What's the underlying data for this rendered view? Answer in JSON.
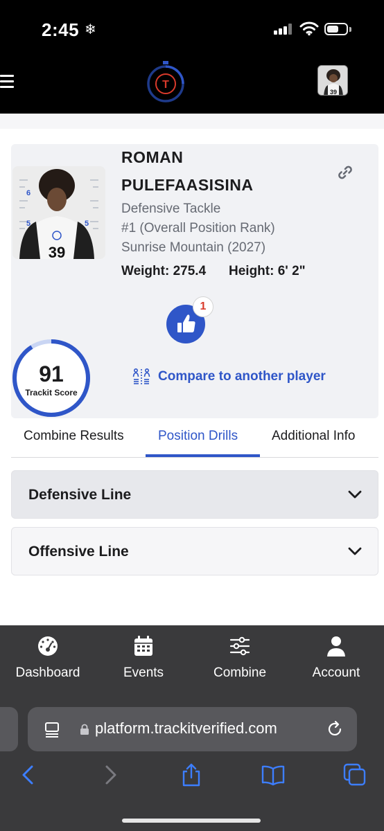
{
  "status_bar": {
    "time": "2:45",
    "snow_symbol": "❄"
  },
  "header": {
    "logo_letter": "T"
  },
  "player": {
    "first_name": "ROMAN",
    "last_name": "PULEFAASISINA",
    "position": "Defensive Tackle",
    "rank": "#1 (Overall Position Rank)",
    "school": "Sunrise Mountain (2027)",
    "weight_label": "Weight:",
    "weight_value": "275.4",
    "height_label": "Height:",
    "height_value": "6' 2\"",
    "jersey_number": "39"
  },
  "likes": {
    "count": "1"
  },
  "score": {
    "value": "91",
    "label": "Trackit Score",
    "ring_fill_fraction": 0.91
  },
  "compare": {
    "label": "Compare to another player"
  },
  "tabs": [
    {
      "label": "Combine Results",
      "active": false
    },
    {
      "label": "Position Drills",
      "active": true
    },
    {
      "label": "Additional Info",
      "active": false
    }
  ],
  "accordions": [
    {
      "title": "Defensive Line"
    },
    {
      "title": "Offensive Line"
    }
  ],
  "bottom_nav": [
    {
      "label": "Dashboard",
      "icon": "dashboard-icon"
    },
    {
      "label": "Events",
      "icon": "calendar-icon"
    },
    {
      "label": "Combine",
      "icon": "sliders-icon"
    },
    {
      "label": "Account",
      "icon": "person-icon"
    }
  ],
  "browser": {
    "url": "platform.trackitverified.com"
  },
  "colors": {
    "accent": "#2f56c8",
    "badge_red": "#d93a2b",
    "nav_bg": "#3a3a3c"
  }
}
